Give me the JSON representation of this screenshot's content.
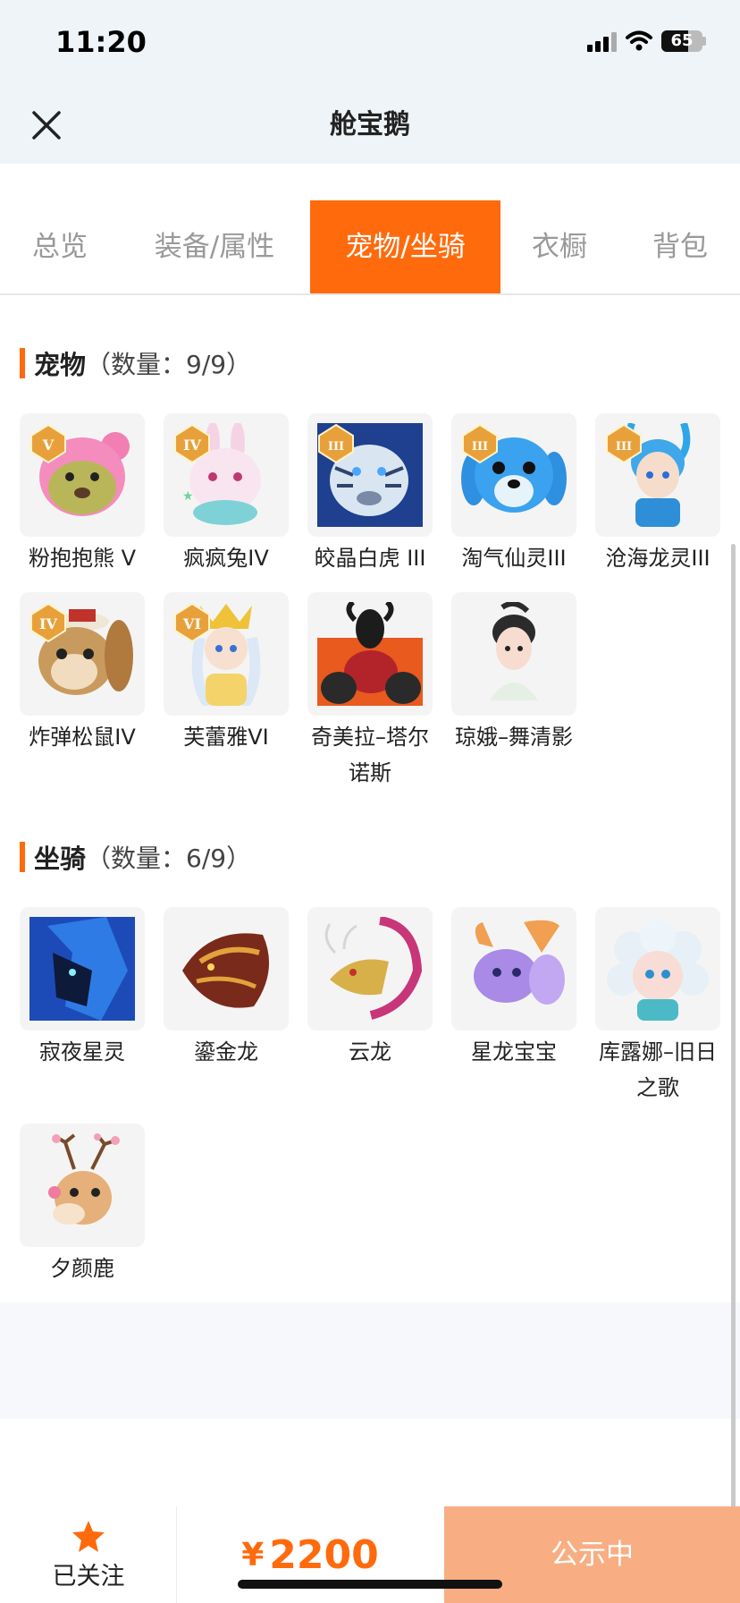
{
  "status_bar": {
    "time": "11:20",
    "battery": "65"
  },
  "header": {
    "title": "舱宝鹅"
  },
  "tabs": [
    {
      "label": "总览"
    },
    {
      "label": "装备/属性"
    },
    {
      "label": "宠物/坐骑"
    },
    {
      "label": "衣橱"
    },
    {
      "label": "背包"
    }
  ],
  "active_tab": "宠物/坐骑",
  "pets": {
    "title": "宠物",
    "count": "（数量：9/9）",
    "items": [
      {
        "name": "粉抱抱熊 V",
        "tier": "V"
      },
      {
        "name": "疯疯兔IV",
        "tier": "IV"
      },
      {
        "name": "皎晶白虎 III",
        "tier": "III"
      },
      {
        "name": "淘气仙灵III",
        "tier": "III"
      },
      {
        "name": "沧海龙灵III",
        "tier": "III"
      },
      {
        "name": "炸弹松鼠IV",
        "tier": "IV"
      },
      {
        "name": "芙蕾雅VI",
        "tier": "VI"
      },
      {
        "name": "奇美拉–塔尔诺斯"
      },
      {
        "name": "琼娥–舞清影"
      }
    ]
  },
  "mounts": {
    "title": "坐骑",
    "count": "（数量：6/9）",
    "items": [
      {
        "name": "寂夜星灵"
      },
      {
        "name": "鎏金龙"
      },
      {
        "name": "云龙"
      },
      {
        "name": "星龙宝宝"
      },
      {
        "name": "库露娜–旧日之歌"
      },
      {
        "name": "夕颜鹿"
      }
    ]
  },
  "bottom_bar": {
    "follow_label": "已关注",
    "currency": "¥",
    "price": "2200",
    "status_button": "公示中"
  },
  "colors": {
    "accent": "#ff6a0c",
    "status_button_bg": "#f8ae82",
    "header_bg": "#eef4f7"
  }
}
